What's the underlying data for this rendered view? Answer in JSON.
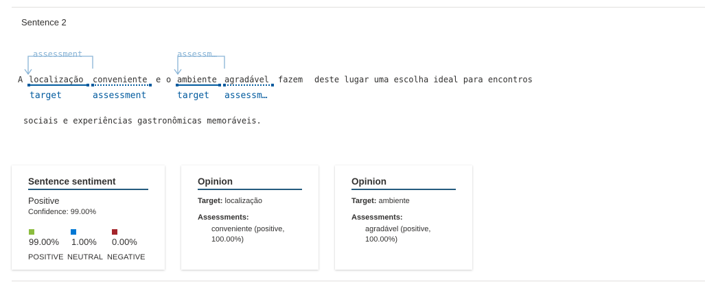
{
  "header": {
    "sentence_label": "Sentence 2"
  },
  "text": {
    "tokens": [
      "A",
      "localização",
      "conveniente",
      "e",
      "o",
      "ambiente",
      "agradável",
      "fazem",
      "deste lugar uma escolha ideal para encontros"
    ],
    "line2": "sociais e experiências gastronômicas memoráveis."
  },
  "annotations": {
    "tag_localizacao": "target",
    "tag_conveniente": "assessment",
    "tag_ambiente": "target",
    "tag_agradavel": "assessm…",
    "relation_1": "assessment",
    "relation_2": "assessm…"
  },
  "cards": {
    "sentiment": {
      "title": "Sentence sentiment",
      "label": "Positive",
      "confidence": "Confidence: 99.00%",
      "positive_pct": "99.00%",
      "neutral_pct": "1.00%",
      "negative_pct": "0.00%",
      "positive_label": "POSITIVE",
      "neutral_label": "NEUTRAL",
      "negative_label": "NEGATIVE"
    },
    "opinion1": {
      "title": "Opinion",
      "target_label": "Target:",
      "target_value": "localização",
      "assessments_label": "Assessments:",
      "assessment_value": "conveniente (positive, 100.00%)"
    },
    "opinion2": {
      "title": "Opinion",
      "target_label": "Target:",
      "target_value": "ambiente",
      "assessments_label": "Assessments:",
      "assessment_value": "agradável (positive, 100.00%)"
    }
  },
  "colors": {
    "positive": "#8cbd3f",
    "neutral": "#0078d4",
    "negative": "#a4262c",
    "annotation": "#005a9e",
    "relation_arrow": "#89b4d6"
  }
}
